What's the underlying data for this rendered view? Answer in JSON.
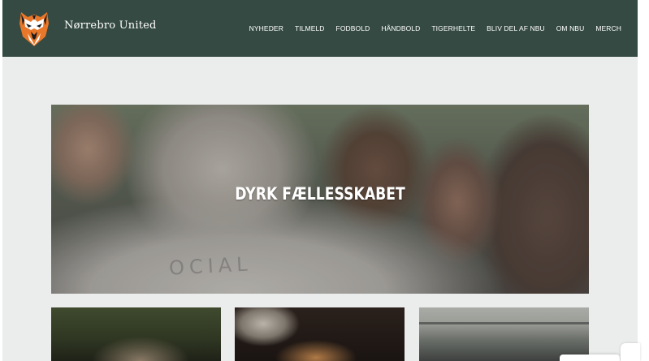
{
  "site": {
    "name": "Nørrebro United",
    "logo_icon": "tiger-logo-icon"
  },
  "nav": {
    "items": [
      {
        "label": "NYHEDER"
      },
      {
        "label": "TILMELD"
      },
      {
        "label": "FODBOLD"
      },
      {
        "label": "HÅNDBOLD"
      },
      {
        "label": "TIGERHELTE"
      },
      {
        "label": "BLIV DEL AF NBU"
      },
      {
        "label": "OM NBU"
      },
      {
        "label": "MERCH"
      }
    ]
  },
  "hero": {
    "title": "DYRK FÆLLESSKABET",
    "shirt_text": "OCIAL"
  },
  "cards": [
    {
      "id": "card-1"
    },
    {
      "id": "card-2"
    },
    {
      "id": "card-3"
    }
  ],
  "colors": {
    "header_bg": "#354a42",
    "page_bg": "#ebecec",
    "logo_orange": "#e8772a"
  }
}
